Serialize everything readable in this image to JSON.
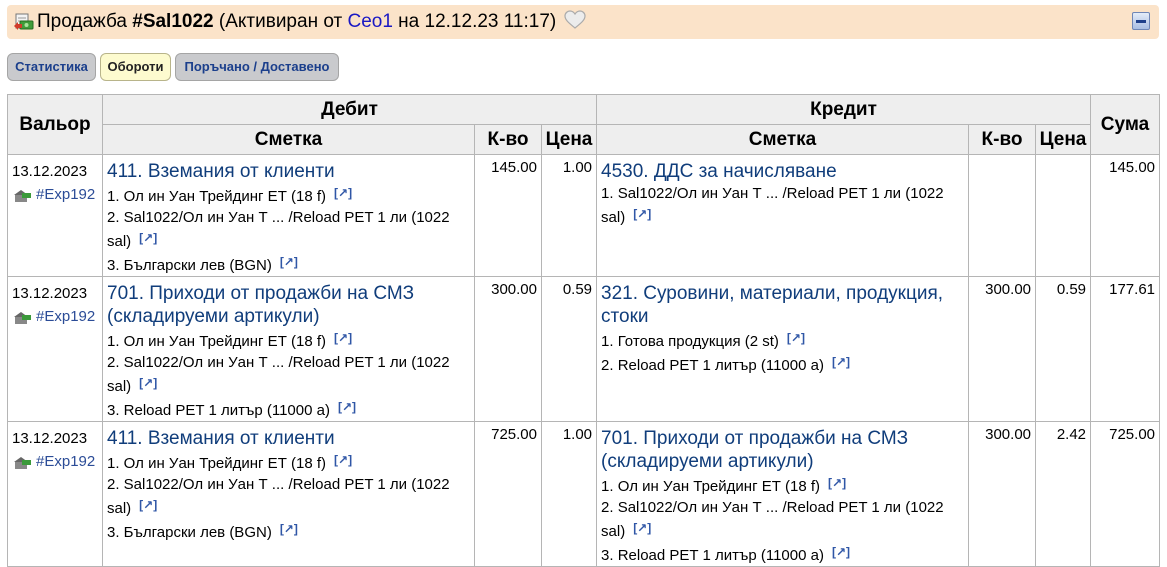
{
  "title": {
    "prefix": "Продажба ",
    "id": "#Sal1022",
    "status_open": " (Активиран от ",
    "author": "Ceo1",
    "status_close": " на 12.12.23 11:17)",
    "icon": "document-money-icon",
    "favorite_icon": "heart-icon",
    "collapse_icon": "minus-icon"
  },
  "tabs": [
    {
      "label": "Статистика",
      "active": false
    },
    {
      "label": "Обороти",
      "active": true
    },
    {
      "label": "Поръчано / Доставено",
      "active": false
    }
  ],
  "table": {
    "headers": {
      "valor": "Вальор",
      "debit": "Дебит",
      "credit": "Кредит",
      "sum": "Сума",
      "account": "Сметка",
      "qty": "К-во",
      "price": "Цена"
    },
    "link_glyph": "[↗]",
    "rows": [
      {
        "date": "13.12.2023",
        "doc": "#Exp192",
        "debit": {
          "account": "411. Вземания от клиенти",
          "items": [
            "1. Ол ин Уан Трейдинг ЕТ (18 f)",
            "2. Sal1022/Ол ин Уан Т ... /Reload PET 1 ли (1022 sal)",
            "3. Български лев (BGN)"
          ],
          "qty": "145.00",
          "price": "1.00"
        },
        "credit": {
          "account": "4530. ДДС за начисляване",
          "items": [
            "1. Sal1022/Ол ин Уан Т ... /Reload PET 1 ли (1022 sal)"
          ],
          "qty": "",
          "price": ""
        },
        "sum": "145.00"
      },
      {
        "date": "13.12.2023",
        "doc": "#Exp192",
        "debit": {
          "account": "701. Приходи от продажби на СМЗ (складируеми артикули)",
          "items": [
            "1. Ол ин Уан Трейдинг ЕТ (18 f)",
            "2. Sal1022/Ол ин Уан Т ... /Reload PET 1 ли (1022 sal)",
            "3. Reload PET 1 литър (11000 a)"
          ],
          "qty": "300.00",
          "price": "0.59"
        },
        "credit": {
          "account": "321. Суровини, материали, продукция, стоки",
          "items": [
            "1. Готова продукция (2 st)",
            "2. Reload PET 1 литър (11000 a)"
          ],
          "qty": "300.00",
          "price": "0.59"
        },
        "sum": "177.61"
      },
      {
        "date": "13.12.2023",
        "doc": "#Exp192",
        "debit": {
          "account": "411. Вземания от клиенти",
          "items": [
            "1. Ол ин Уан Трейдинг ЕТ (18 f)",
            "2. Sal1022/Ол ин Уан Т ... /Reload PET 1 ли (1022 sal)",
            "3. Български лев (BGN)"
          ],
          "qty": "725.00",
          "price": "1.00"
        },
        "credit": {
          "account": "701. Приходи от продажби на СМЗ (складируеми артикули)",
          "items": [
            "1. Ол ин Уан Трейдинг ЕТ (18 f)",
            "2. Sal1022/Ол ин Уан Т ... /Reload PET 1 ли (1022 sal)",
            "3. Reload PET 1 литър (11000 a)"
          ],
          "qty": "300.00",
          "price": "2.42"
        },
        "sum": "725.00"
      }
    ]
  }
}
